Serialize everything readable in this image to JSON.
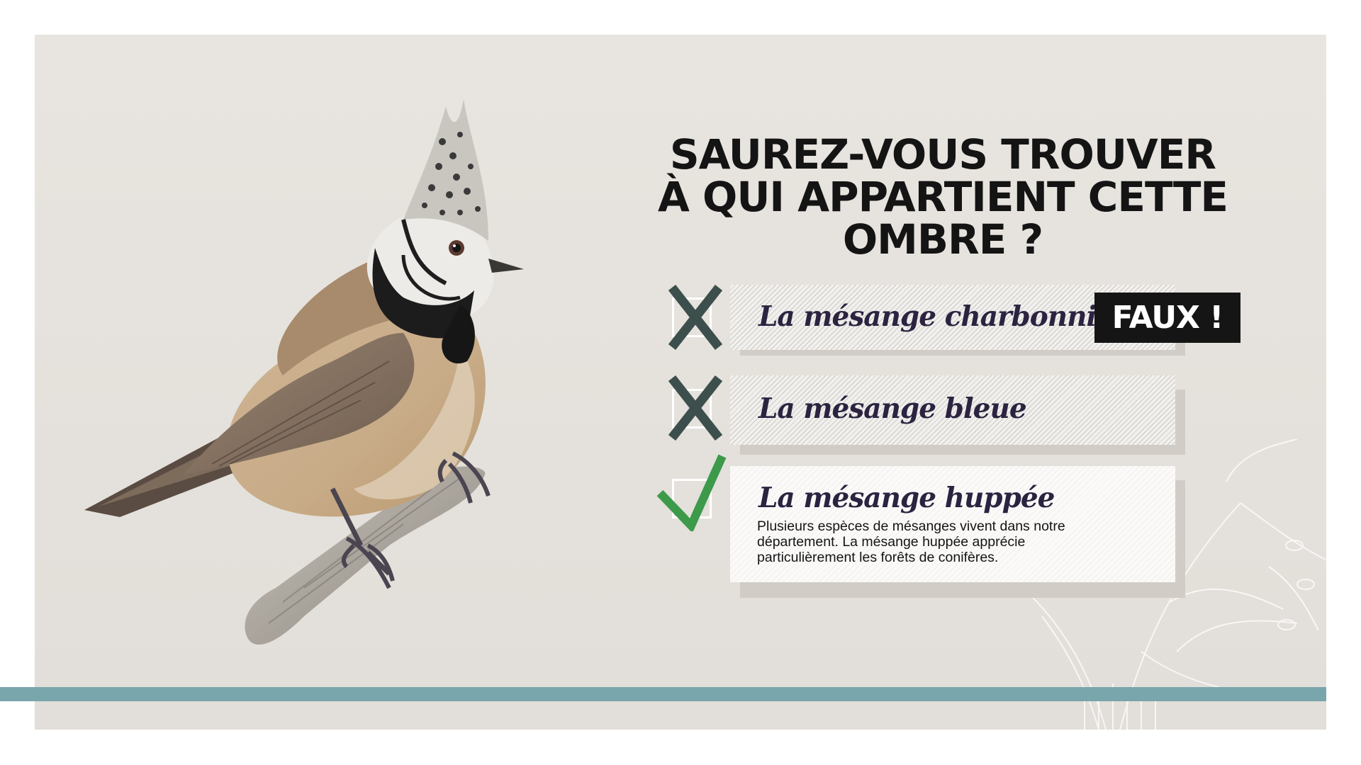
{
  "quiz": {
    "title_line1": "SAUREZ-VOUS TROUVER",
    "title_line2": "À QUI APPARTIENT CETTE OMBRE ?",
    "answers": [
      {
        "label": "La mésange charbonnière",
        "status": "wrong",
        "mark_icon": "cross-icon",
        "mark_color": "#3d4f4c"
      },
      {
        "label": "La mésange bleue",
        "status": "wrong",
        "mark_icon": "cross-icon",
        "mark_color": "#3d4f4c"
      },
      {
        "label": "La mésange huppée",
        "status": "correct",
        "mark_icon": "check-icon",
        "mark_color": "#3d9a4a",
        "explanation_line1": "Plusieurs espèces de mésanges vivent dans notre",
        "explanation_line2": "département. La mésange huppée apprécie",
        "explanation_line3": "particulièrement les forêts de conifères."
      }
    ],
    "verdict": "FAUX !"
  },
  "illustration": {
    "icon": "crested-tit-bird-illustration"
  },
  "colors": {
    "panel": "#e6e3de",
    "accent_bar": "#79a5ac",
    "title": "#141414",
    "answer_text": "#2b2340",
    "verdict_bg": "#151515",
    "wrong_mark": "#3d4f4c",
    "correct_mark": "#3d9a4a"
  }
}
